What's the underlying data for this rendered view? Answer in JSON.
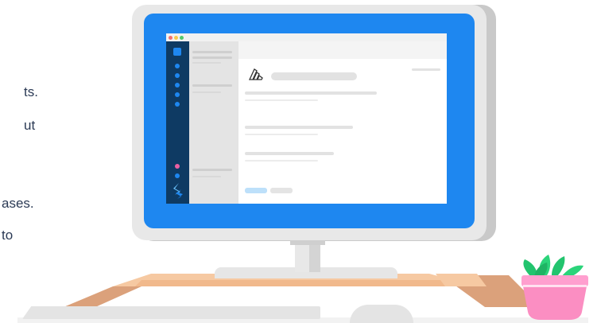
{
  "side_text": {
    "line1": "ts.",
    "line2": "ut",
    "line3": "ases.",
    "line4": "to"
  },
  "app_window": {
    "titlebar_dots": [
      "#f26f6f",
      "#f5c84c",
      "#52c96b"
    ],
    "rail_accent": "#1e87f0",
    "rail_bg": "#0e3a63",
    "pink_dot": "#e95fa2"
  },
  "colors": {
    "screen_blue": "#1e87f0",
    "desk_peach": "#f6c9a2",
    "desk_brown": "#dba17b",
    "pot_pink": "#fb8ec2",
    "leaf_green": "#2bd47a"
  },
  "icons": {
    "app_logo": "sanity-logo-icon",
    "rail_logo": "stackbit-logo-icon"
  }
}
